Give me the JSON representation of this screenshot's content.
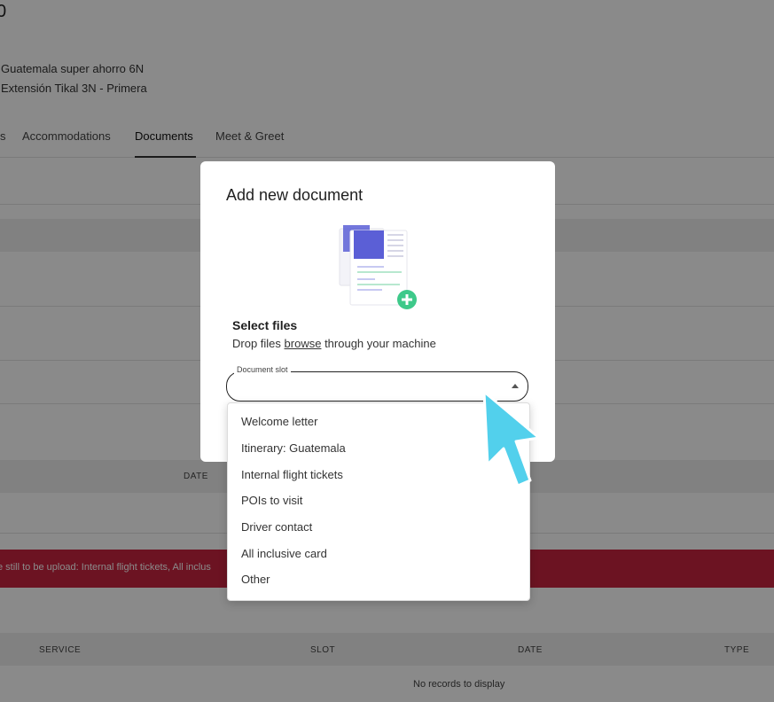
{
  "page": {
    "title_fragment": "0",
    "subtitle_1": "Guatemala super ahorro 6N",
    "subtitle_2": "Extensión Tikal 3N - Primera"
  },
  "tabs": [
    {
      "label": "s"
    },
    {
      "label": "Accommodations"
    },
    {
      "label": "Documents"
    },
    {
      "label": "Meet & Greet"
    }
  ],
  "upper_table": {
    "date_header": "DATE"
  },
  "alert": {
    "text": "e still to be upload: Internal flight tickets, All inclus"
  },
  "lower_table": {
    "headers": [
      "SERVICE",
      "SLOT",
      "DATE",
      "TYPE"
    ],
    "empty_text": "No records to display"
  },
  "modal": {
    "title": "Add new document",
    "select_title": "Select files",
    "drop_prefix": "Drop files ",
    "drop_link": "browse",
    "drop_suffix": " through your machine",
    "slot_label": "Document slot",
    "slot_value": ""
  },
  "dropdown": {
    "options": [
      "Welcome letter",
      "Itinerary: Guatemala",
      "Internal flight tickets",
      "POIs to visit",
      "Driver contact",
      "All inclusive card",
      "Other"
    ]
  },
  "colors": {
    "accent": "#5b5fd6",
    "success": "#3ec98a",
    "alert": "#c8243f",
    "cursor": "#52d0ec"
  },
  "icons": {
    "illustration": "documents-add-icon",
    "cursor": "pointer-cursor-icon",
    "arrow": "caret-up-icon"
  }
}
